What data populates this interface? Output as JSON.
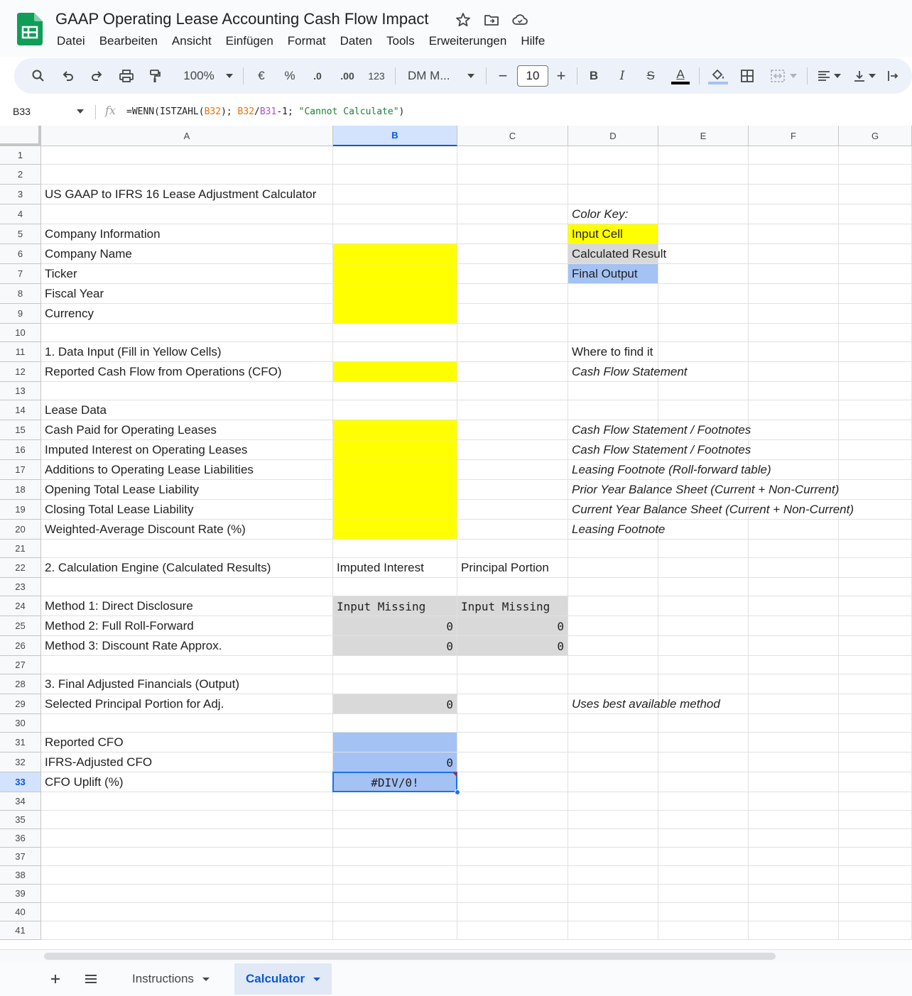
{
  "app": {
    "title": "GAAP Operating Lease Accounting Cash Flow Impact",
    "menu": [
      "Datei",
      "Bearbeiten",
      "Ansicht",
      "Einfügen",
      "Format",
      "Daten",
      "Tools",
      "Erweiterungen",
      "Hilfe"
    ]
  },
  "toolbar": {
    "zoom": "100%",
    "currency": "€",
    "percent": "%",
    "dec_decrease": ".0",
    "dec_increase": ".00",
    "number_format": "123",
    "font": "DM M...",
    "font_size": "10",
    "minus": "−",
    "plus": "+",
    "bold": "B",
    "italic": "I",
    "strikethrough": "S",
    "text_color": "A"
  },
  "formula_bar": {
    "cell_ref": "B33",
    "fx": "fx",
    "formula_parts": [
      "=WENN(ISTZAHL(",
      "B32",
      "); ",
      "B32",
      "/",
      "B31",
      "-1; ",
      "\"Cannot Calculate\"",
      ")"
    ]
  },
  "grid": {
    "columns": [
      "A",
      "B",
      "C",
      "D",
      "E",
      "F",
      "G"
    ],
    "selected_column": "B",
    "rows": [
      "1",
      "2",
      "3",
      "4",
      "5",
      "6",
      "7",
      "8",
      "9",
      "10",
      "11",
      "12",
      "13",
      "14",
      "15",
      "16",
      "17",
      "18",
      "19",
      "20",
      "21",
      "22",
      "23",
      "24",
      "25",
      "26",
      "27",
      "28",
      "29",
      "30",
      "31",
      "32",
      "33",
      "34",
      "35",
      "36",
      "37",
      "38",
      "39",
      "40",
      "41"
    ],
    "selected_row": "33",
    "cells": {
      "A3": "US GAAP to IFRS 16 Lease Adjustment Calculator",
      "D4": "Color Key:",
      "A5": "Company Information",
      "D5": "Input Cell",
      "A6": "Company Name",
      "D6": "Calculated Result",
      "A7": "Ticker",
      "D7": "Final Output",
      "A8": "Fiscal Year",
      "A9": "Currency",
      "A11": "1. Data Input (Fill in Yellow Cells)",
      "D11": "Where to find it",
      "A12": "Reported Cash Flow from Operations (CFO)",
      "D12": "Cash Flow Statement",
      "A14": "Lease Data",
      "A15": "Cash Paid for Operating Leases",
      "D15": "Cash Flow Statement / Footnotes",
      "A16": "Imputed Interest on Operating Leases",
      "D16": "Cash Flow Statement / Footnotes",
      "A17": "Additions to Operating Lease Liabilities",
      "D17": "Leasing Footnote (Roll-forward table)",
      "A18": "Opening Total Lease Liability",
      "D18": "Prior Year Balance Sheet (Current + Non-Current)",
      "A19": "Closing Total Lease Liability",
      "D19": "Current Year Balance Sheet (Current + Non-Current)",
      "A20": "Weighted-Average Discount Rate (%)",
      "D20": "Leasing Footnote",
      "A22": "2. Calculation Engine (Calculated Results)",
      "B22": "Imputed Interest",
      "C22": "Principal Portion",
      "A24": "Method 1: Direct Disclosure",
      "B24": "Input Missing",
      "C24": "Input Missing",
      "A25": "Method 2: Full Roll-Forward",
      "B25": "0",
      "C25": "0",
      "A26": "Method 3: Discount Rate Approx.",
      "B26": "0",
      "C26": "0",
      "A28": "3. Final Adjusted Financials (Output)",
      "A29": "Selected Principal Portion for Adj.",
      "B29": "0",
      "D29": "Uses best available method",
      "A31": "Reported CFO",
      "A32": "IFRS-Adjusted CFO",
      "B32": "0",
      "A33": "CFO Uplift (%)",
      "B33": "#DIV/0!"
    }
  },
  "colors": {
    "input": "#ffff00",
    "calculated": "#d9d9d9",
    "output": "#a4c2f4",
    "selection": "#1a73e8"
  },
  "sheets": {
    "tabs": [
      "Instructions",
      "Calculator"
    ],
    "active": "Calculator"
  }
}
